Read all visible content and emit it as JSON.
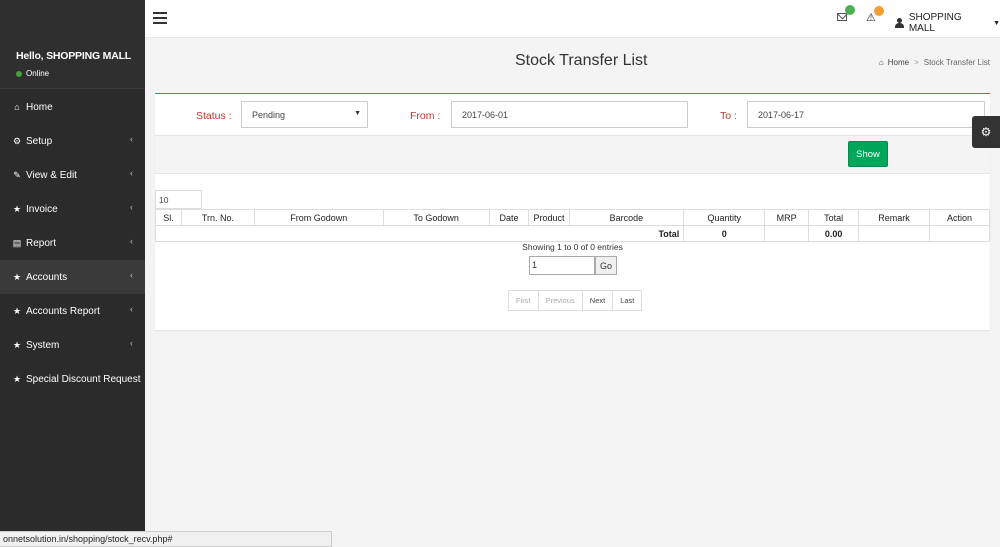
{
  "sidebar": {
    "greeting": "Hello, SHOPPING MALL",
    "status": "Online",
    "items": [
      {
        "label": "Home",
        "icon": "home-icon",
        "glyph": "⌂",
        "has_submenu": false
      },
      {
        "label": "Setup",
        "icon": "cogs-icon",
        "glyph": "⚙",
        "has_submenu": true
      },
      {
        "label": "View & Edit",
        "icon": "edit-icon",
        "glyph": "✎",
        "has_submenu": true
      },
      {
        "label": "Invoice",
        "icon": "star-icon",
        "glyph": "★",
        "has_submenu": true
      },
      {
        "label": "Report",
        "icon": "file-icon",
        "glyph": "▤",
        "has_submenu": true
      },
      {
        "label": "Accounts",
        "icon": "star-icon",
        "glyph": "★",
        "has_submenu": true
      },
      {
        "label": "Accounts Report",
        "icon": "star-icon",
        "glyph": "★",
        "has_submenu": true
      },
      {
        "label": "System",
        "icon": "star-icon",
        "glyph": "★",
        "has_submenu": true
      },
      {
        "label": "Special Discount Request",
        "icon": "star-icon",
        "glyph": "★",
        "has_submenu": false
      }
    ]
  },
  "header": {
    "user_name": "SHOPPING MALL"
  },
  "page": {
    "title": "Stock Transfer List",
    "breadcrumb_home": "Home",
    "breadcrumb_current": "Stock Transfer List"
  },
  "filters": {
    "status_label": "Status :",
    "status_value": "Pending",
    "from_label": "From :",
    "from_value": "2017-06-01",
    "to_label": "To :",
    "to_value": "2017-06-17",
    "show_label": "Show"
  },
  "table": {
    "page_size": "10",
    "columns": [
      "Sl.",
      "Trn. No.",
      "From Godown",
      "To Godown",
      "Date",
      "Product",
      "Barcode",
      "Quantity",
      "MRP",
      "Total",
      "Remark",
      "Action"
    ],
    "footer": {
      "total_label": "Total",
      "quantity": "0",
      "total": "0.00"
    }
  },
  "pagination": {
    "info": "Showing 1 to 0 of 0 entries",
    "goto_value": "1",
    "go_label": "Go",
    "first": "First",
    "previous": "Previous",
    "next": "Next",
    "last": "Last"
  },
  "status_bar": {
    "url": "onnetsolution.in/shopping/stock_recv.php#"
  },
  "colors": {
    "sidebar_bg": "#2b2b2b",
    "accent_green": "#00a65a",
    "label_red": "#c0392b"
  }
}
